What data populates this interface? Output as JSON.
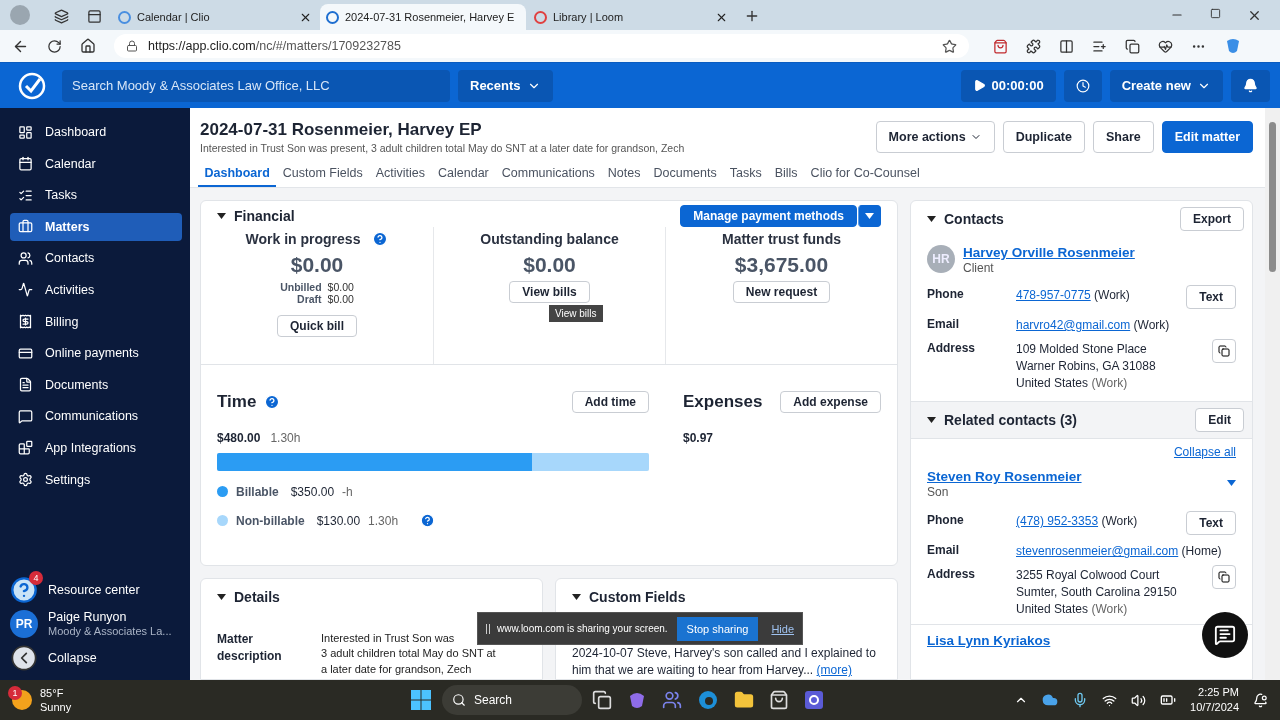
{
  "browser": {
    "tabs": [
      {
        "title": "Calendar | Clio",
        "selected": false
      },
      {
        "title": "2024-07-31 Rosenmeier, Harvey E",
        "selected": true
      },
      {
        "title": "Library | Loom",
        "selected": false
      }
    ],
    "url_host": "https://app.clio.com",
    "url_path": "/nc/#/matters/1709232785"
  },
  "app_header": {
    "search_placeholder": "Search Moody & Associates Law Office, LLC",
    "recents": "Recents",
    "timer": "00:00:00",
    "create_new": "Create new"
  },
  "sidebar": {
    "items": [
      {
        "label": "Dashboard",
        "selected": false
      },
      {
        "label": "Calendar",
        "selected": false
      },
      {
        "label": "Tasks",
        "selected": false
      },
      {
        "label": "Matters",
        "selected": true
      },
      {
        "label": "Contacts",
        "selected": false
      },
      {
        "label": "Activities",
        "selected": false
      },
      {
        "label": "Billing",
        "selected": false
      },
      {
        "label": "Online payments",
        "selected": false
      },
      {
        "label": "Documents",
        "selected": false
      },
      {
        "label": "Communications",
        "selected": false
      },
      {
        "label": "App Integrations",
        "selected": false
      },
      {
        "label": "Settings",
        "selected": false
      }
    ],
    "resource_center": {
      "label": "Resource center",
      "badge": "4"
    },
    "user": {
      "initials": "PR",
      "name": "Paige Runyon",
      "org": "Moody & Associates La..."
    },
    "collapse": "Collapse"
  },
  "matter": {
    "title": "2024-07-31 Rosenmeier, Harvey EP",
    "subtitle": "Interested in Trust Son was present, 3 adult children total May do SNT at a later date for grandson, Zech",
    "more_actions": "More actions",
    "actions": [
      "Duplicate",
      "Share"
    ],
    "primary_action": "Edit matter"
  },
  "tabs": [
    {
      "label": "Dashboard",
      "selected": true
    },
    {
      "label": "Custom Fields",
      "selected": false
    },
    {
      "label": "Activities",
      "selected": false
    },
    {
      "label": "Calendar",
      "selected": false
    },
    {
      "label": "Communications",
      "selected": false
    },
    {
      "label": "Notes",
      "selected": false
    },
    {
      "label": "Documents",
      "selected": false
    },
    {
      "label": "Tasks",
      "selected": false
    },
    {
      "label": "Bills",
      "selected": false
    },
    {
      "label": "Clio for Co-Counsel",
      "selected": false
    }
  ],
  "financial": {
    "title": "Financial",
    "manage_button": "Manage payment methods",
    "cards": [
      {
        "heading": "Work in progress",
        "help": true,
        "amount": "$0.00",
        "lines": [
          {
            "label": "Unbilled",
            "value": "$0.00"
          },
          {
            "label": "Draft",
            "value": "$0.00"
          }
        ],
        "button": "Quick bill"
      },
      {
        "heading": "Outstanding balance",
        "help": false,
        "amount": "$0.00",
        "button": "View bills",
        "tooltip": "View bills"
      },
      {
        "heading": "Matter trust funds",
        "help": false,
        "amount": "$3,675.00",
        "button": "New request"
      }
    ]
  },
  "time": {
    "title": "Time",
    "button": "Add time",
    "total": "$480.00",
    "hours": "1.30h",
    "legend": [
      {
        "label": "Billable",
        "amount": "$350.00",
        "hours": "-h",
        "color": "#2b9cf3",
        "level": 0.73,
        "help": false
      },
      {
        "label": "Non-billable",
        "amount": "$130.00",
        "hours": "1.30h",
        "color": "#a7d7fb",
        "level": 0.27,
        "help": true
      }
    ]
  },
  "expenses": {
    "title": "Expenses",
    "button": "Add expense",
    "total": "$0.97"
  },
  "details": {
    "title": "Details",
    "fields": [
      {
        "label": "Matter description",
        "lines": [
          "Interested in Trust Son was",
          "3 adult children total May do SNT at",
          "a later date for grandson, Zech"
        ]
      }
    ]
  },
  "custom_fields": {
    "title": "Custom Fields",
    "text": "2024-10-07 Steve, Harvey's son called and I explained to him that we are waiting to hear from Harvey...",
    "more": "(more)"
  },
  "contacts": {
    "title": "Contacts",
    "export": "Export",
    "client": {
      "initials": "HR",
      "name": "Harvey Orville Rosenmeier",
      "role": "Client",
      "fields": [
        {
          "kind": "phone",
          "label": "Phone",
          "link": "478-957-0775",
          "note": "(Work)",
          "action": "Text"
        },
        {
          "kind": "email",
          "label": "Email",
          "link": "harvro42@gmail.com",
          "note": "(Work)"
        },
        {
          "kind": "address",
          "label": "Address",
          "lines": [
            "109 Molded Stone Place",
            "Warner Robins, GA 31088",
            "United States"
          ],
          "note": "(Work)"
        }
      ]
    },
    "related": {
      "title": "Related contacts (3)",
      "edit": "Edit",
      "collapse_all": "Collapse all",
      "person": {
        "name": "Steven Roy Rosenmeier",
        "role": "Son",
        "expanded": true,
        "fields": [
          {
            "kind": "phone",
            "label": "Phone",
            "link": "(478) 952-3353",
            "note": "(Work)",
            "action": "Text"
          },
          {
            "kind": "email",
            "label": "Email",
            "link": "stevenrosenmeier@gmail.com",
            "note": "(Home)"
          },
          {
            "kind": "address",
            "label": "Address",
            "lines": [
              "3255 Royal Colwood Court",
              "Sumter, South Carolina 29150",
              "United States"
            ],
            "note": "(Work)"
          }
        ]
      },
      "next_name": "Lisa Lynn Kyriakos"
    }
  },
  "loom_banner": {
    "message": "www.loom.com is sharing your screen.",
    "stop": "Stop sharing",
    "hide": "Hide"
  },
  "taskbar": {
    "temperature": "85°F",
    "condition": "Sunny",
    "weather_badge": "1",
    "search": "Search",
    "time": "2:25 PM",
    "date": "10/7/2024"
  }
}
